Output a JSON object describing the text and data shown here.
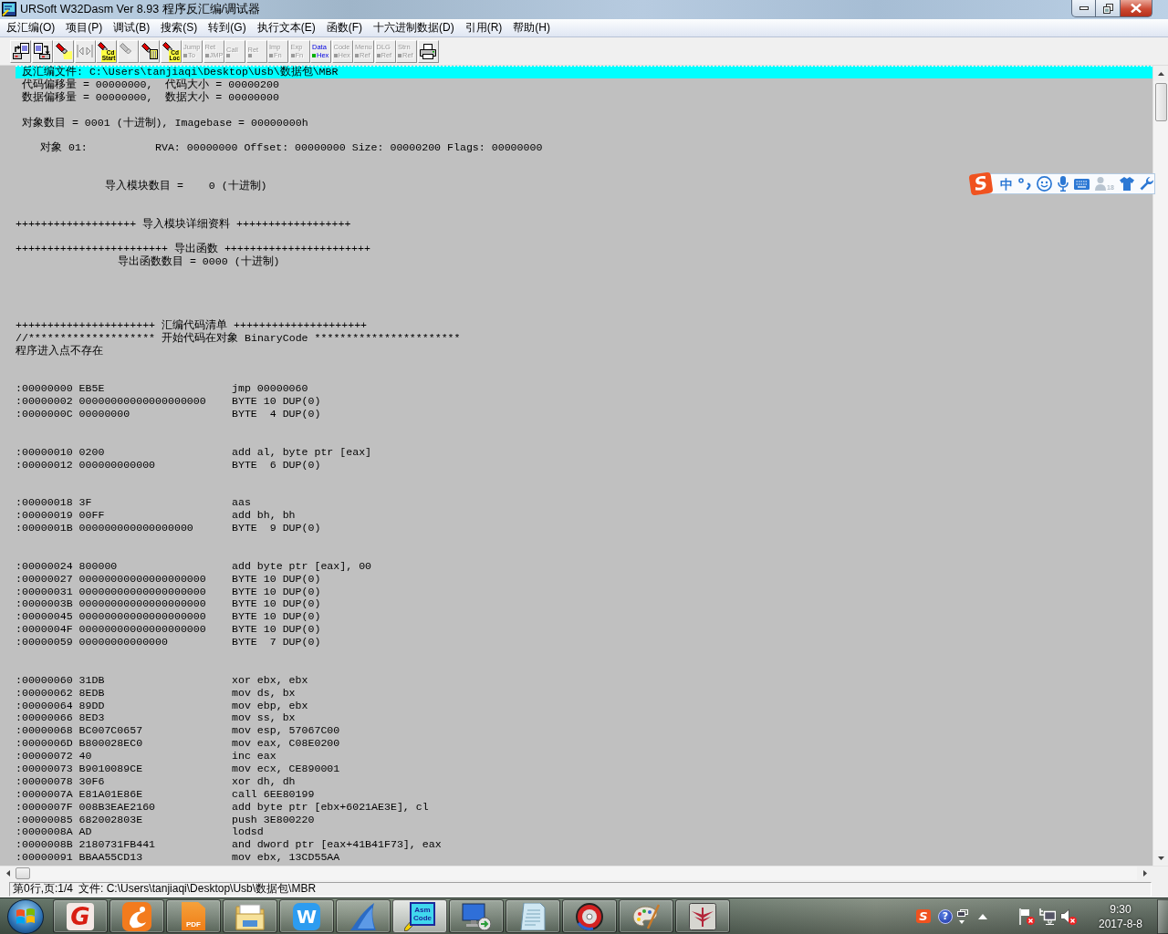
{
  "window": {
    "title": "URSoft W32Dasm Ver 8.93 程序反汇编/调试器"
  },
  "menu": [
    "反汇编(O)",
    "项目(P)",
    "调试(B)",
    "搜索(S)",
    "转到(G)",
    "执行文本(E)",
    "函数(F)",
    "十六进制数据(D)",
    "引用(R)",
    "帮助(H)"
  ],
  "toolbar": {
    "buttons": [
      {
        "kind": "icon",
        "disabled": false
      },
      {
        "kind": "icon",
        "disabled": false
      },
      {
        "kind": "icon",
        "disabled": false
      },
      {
        "kind": "icon",
        "disabled": true
      },
      {
        "kind": "mixed",
        "disabled": false,
        "lines": [
          "Cd",
          "Start"
        ]
      },
      {
        "kind": "icon",
        "disabled": true
      },
      {
        "kind": "icon",
        "disabled": false
      },
      {
        "kind": "mixed",
        "disabled": false,
        "lines": [
          "Cd",
          "Loc"
        ]
      },
      {
        "kind": "text",
        "disabled": true,
        "lines": [
          "Jump",
          "To"
        ]
      },
      {
        "kind": "text",
        "disabled": true,
        "lines": [
          "Ret",
          "JMP"
        ]
      },
      {
        "kind": "text",
        "disabled": true,
        "lines": [
          "Call"
        ]
      },
      {
        "kind": "text",
        "disabled": true,
        "lines": [
          "Ret"
        ]
      },
      {
        "kind": "text",
        "disabled": true,
        "lines": [
          "Imp",
          "Fn"
        ]
      },
      {
        "kind": "text",
        "disabled": true,
        "lines": [
          "Exp",
          "Fn"
        ]
      },
      {
        "kind": "text",
        "disabled": false,
        "lines": [
          "Data",
          "Hex"
        ]
      },
      {
        "kind": "text",
        "disabled": true,
        "lines": [
          "Code",
          "Hex"
        ]
      },
      {
        "kind": "text",
        "disabled": true,
        "lines": [
          "Menu",
          "Ref"
        ]
      },
      {
        "kind": "text",
        "disabled": true,
        "lines": [
          "DLG",
          "Ref"
        ]
      },
      {
        "kind": "text",
        "disabled": true,
        "lines": [
          "Strn",
          "Ref"
        ]
      },
      {
        "kind": "icon",
        "disabled": false
      }
    ]
  },
  "listing": {
    "lines": [
      {
        "kind": "header",
        "selected": true,
        "text": "反汇编文件: C:\\Users\\tanjiaqi\\Desktop\\Usb\\数据包\\MBR"
      },
      {
        "kind": "header",
        "selected": false,
        "text": "代码偏移量 = 00000000,  代码大小 = 00000200"
      },
      {
        "kind": "header",
        "selected": false,
        "text": "数据偏移量 = 00000000,  数据大小 = 00000000"
      },
      {
        "kind": "blank",
        "selected": false
      },
      {
        "kind": "header",
        "selected": false,
        "text": "对象数目 = 0001 (十进制), Imagebase = 00000000h"
      },
      {
        "kind": "blank",
        "selected": false
      },
      {
        "kind": "object",
        "selected": false,
        "label": "对象 01:",
        "detail": "RVA: 00000000 Offset: 00000000 Size: 00000200 Flags: 00000000"
      },
      {
        "kind": "blank",
        "selected": false
      },
      {
        "kind": "blank",
        "selected": false
      },
      {
        "kind": "import-summary",
        "selected": false,
        "text": "导入模块数目 =    0 (十进制)"
      },
      {
        "kind": "blank",
        "selected": false
      },
      {
        "kind": "blank",
        "selected": false
      },
      {
        "kind": "banner",
        "selected": false,
        "text": "+++++++++++++++++++ 导入模块详细资料 ++++++++++++++++++"
      },
      {
        "kind": "blank",
        "selected": false
      },
      {
        "kind": "banner",
        "selected": false,
        "text": "++++++++++++++++++++++++ 导出函数 +++++++++++++++++++++++"
      },
      {
        "kind": "export-summary",
        "selected": false,
        "text": "导出函数数目 = 0000 (十进制)"
      },
      {
        "kind": "blank",
        "selected": false
      },
      {
        "kind": "blank",
        "selected": false
      },
      {
        "kind": "blank",
        "selected": false
      },
      {
        "kind": "blank",
        "selected": false
      },
      {
        "kind": "banner",
        "selected": false,
        "text": "++++++++++++++++++++++ 汇编代码清单 +++++++++++++++++++++"
      },
      {
        "kind": "banner",
        "selected": false,
        "text": "//******************** 开始代码在对象 BinaryCode ***********************"
      },
      {
        "kind": "banner",
        "selected": false,
        "text": "程序进入点不存在"
      },
      {
        "kind": "blank",
        "selected": false
      },
      {
        "kind": "blank",
        "selected": false
      },
      {
        "kind": "code",
        "selected": false,
        "code": ":00000000 EB5E",
        "instruction": "jmp 00000060"
      },
      {
        "kind": "code",
        "selected": false,
        "code": ":00000002 00000000000000000000",
        "instruction": "BYTE 10 DUP(0)"
      },
      {
        "kind": "code",
        "selected": false,
        "code": ":0000000C 00000000",
        "instruction": "BYTE  4 DUP(0)"
      },
      {
        "kind": "blank",
        "selected": false
      },
      {
        "kind": "blank",
        "selected": false
      },
      {
        "kind": "code",
        "selected": false,
        "code": ":00000010 0200",
        "instruction": "add al, byte ptr [eax]"
      },
      {
        "kind": "code",
        "selected": false,
        "code": ":00000012 000000000000",
        "instruction": "BYTE  6 DUP(0)"
      },
      {
        "kind": "blank",
        "selected": false
      },
      {
        "kind": "blank",
        "selected": false
      },
      {
        "kind": "code",
        "selected": false,
        "code": ":00000018 3F",
        "instruction": "aas"
      },
      {
        "kind": "code",
        "selected": false,
        "code": ":00000019 00FF",
        "instruction": "add bh, bh"
      },
      {
        "kind": "code",
        "selected": false,
        "code": ":0000001B 000000000000000000",
        "instruction": "BYTE  9 DUP(0)"
      },
      {
        "kind": "blank",
        "selected": false
      },
      {
        "kind": "blank",
        "selected": false
      },
      {
        "kind": "code",
        "selected": false,
        "code": ":00000024 800000",
        "instruction": "add byte ptr [eax], 00"
      },
      {
        "kind": "code",
        "selected": false,
        "code": ":00000027 00000000000000000000",
        "instruction": "BYTE 10 DUP(0)"
      },
      {
        "kind": "code",
        "selected": false,
        "code": ":00000031 00000000000000000000",
        "instruction": "BYTE 10 DUP(0)"
      },
      {
        "kind": "code",
        "selected": false,
        "code": ":0000003B 00000000000000000000",
        "instruction": "BYTE 10 DUP(0)"
      },
      {
        "kind": "code",
        "selected": false,
        "code": ":00000045 00000000000000000000",
        "instruction": "BYTE 10 DUP(0)"
      },
      {
        "kind": "code",
        "selected": false,
        "code": ":0000004F 00000000000000000000",
        "instruction": "BYTE 10 DUP(0)"
      },
      {
        "kind": "code",
        "selected": false,
        "code": ":00000059 00000000000000",
        "instruction": "BYTE  7 DUP(0)"
      },
      {
        "kind": "blank",
        "selected": false
      },
      {
        "kind": "blank",
        "selected": false
      },
      {
        "kind": "code",
        "selected": false,
        "code": ":00000060 31DB",
        "instruction": "xor ebx, ebx"
      },
      {
        "kind": "code",
        "selected": false,
        "code": ":00000062 8EDB",
        "instruction": "mov ds, bx"
      },
      {
        "kind": "code",
        "selected": false,
        "code": ":00000064 89DD",
        "instruction": "mov ebp, ebx"
      },
      {
        "kind": "code",
        "selected": false,
        "code": ":00000066 8ED3",
        "instruction": "mov ss, bx"
      },
      {
        "kind": "code",
        "selected": false,
        "code": ":00000068 BC007C0657",
        "instruction": "mov esp, 57067C00"
      },
      {
        "kind": "code",
        "selected": false,
        "code": ":0000006D B800028EC0",
        "instruction": "mov eax, C08E0200"
      },
      {
        "kind": "code",
        "selected": false,
        "code": ":00000072 40",
        "instruction": "inc eax"
      },
      {
        "kind": "code",
        "selected": false,
        "code": ":00000073 B9010089CE",
        "instruction": "mov ecx, CE890001"
      },
      {
        "kind": "code",
        "selected": false,
        "code": ":00000078 30F6",
        "instruction": "xor dh, dh"
      },
      {
        "kind": "code",
        "selected": false,
        "code": ":0000007A E81A01E86E",
        "instruction": "call 6EE80199"
      },
      {
        "kind": "code",
        "selected": false,
        "code": ":0000007F 008B3EAE2160",
        "instruction": "add byte ptr [ebx+6021AE3E], cl"
      },
      {
        "kind": "code",
        "selected": false,
        "code": ":00000085 682002803E",
        "instruction": "push 3E800220"
      },
      {
        "kind": "code",
        "selected": false,
        "code": ":0000008A AD",
        "instruction": "lodsd"
      },
      {
        "kind": "code",
        "selected": false,
        "code": ":0000008B 2180731FB441",
        "instruction": "and dword ptr [eax+41B41F73], eax"
      },
      {
        "kind": "code",
        "selected": false,
        "code": ":00000091 BBAA55CD13",
        "instruction": "mov ebx, 13CD55AA"
      }
    ]
  },
  "ime_bar": {
    "logo": "S",
    "mode": "中",
    "badge": "18"
  },
  "status_bar": {
    "position": "第0行,页:1/4",
    "file": "文件: C:\\Users\\tanjiaqi\\Desktop\\Usb\\数据包\\MBR"
  },
  "taskbar": {
    "buttons": [
      {
        "selected": false,
        "icon_text": [
          "G"
        ]
      },
      {
        "selected": false
      },
      {
        "selected": false,
        "icon_text": [
          "PDF"
        ]
      },
      {
        "selected": false
      },
      {
        "selected": false,
        "icon_text": [
          "W"
        ]
      },
      {
        "selected": false
      },
      {
        "selected": true,
        "icon_text": [
          "Asm",
          "Code"
        ]
      },
      {
        "selected": false
      },
      {
        "selected": false
      },
      {
        "selected": false
      },
      {
        "selected": false
      },
      {
        "selected": false
      }
    ],
    "tray": {
      "ime_logo": "S",
      "help": "?"
    },
    "clock": {
      "time": "9:30",
      "date": "2017-8-8"
    }
  }
}
